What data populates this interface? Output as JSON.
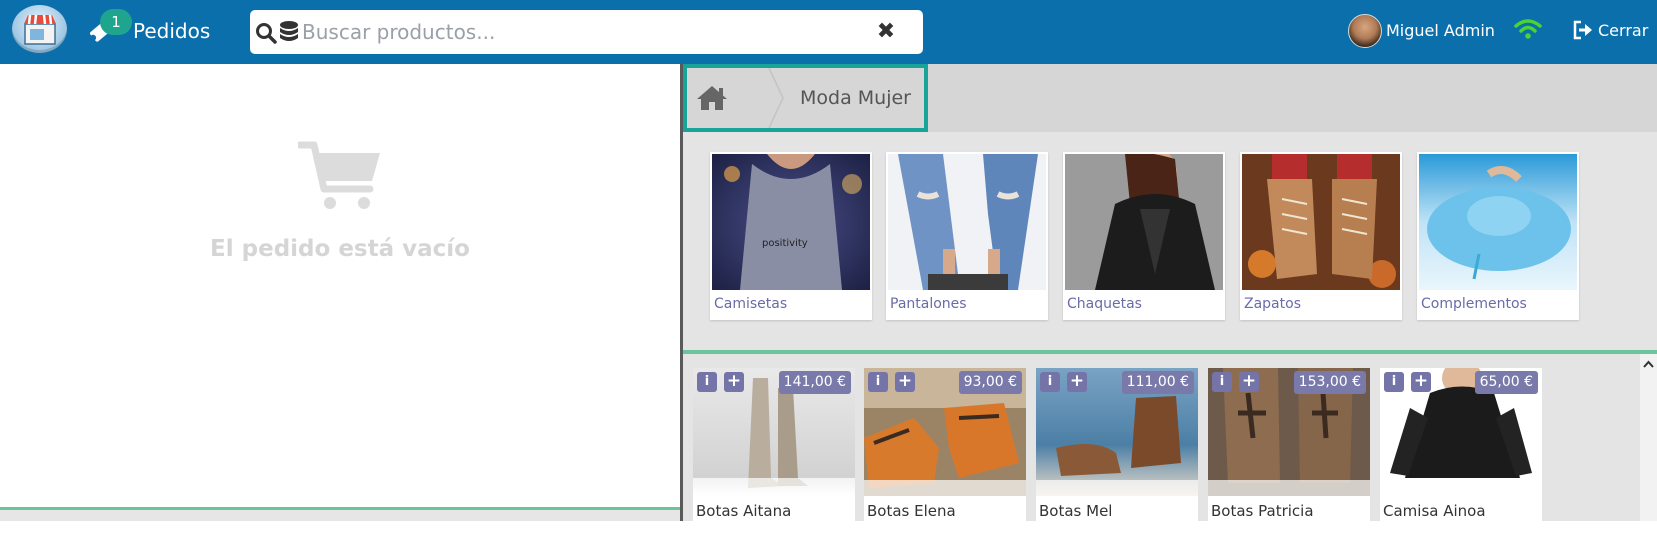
{
  "header": {
    "logo_icon": "store-icon",
    "orders_badge": "1",
    "orders_label": "Pedidos",
    "search": {
      "placeholder": "Buscar productos...",
      "value": ""
    },
    "user_name": "Miguel Admin",
    "logout_label": "Cerrar",
    "colors": {
      "bar": "#0b6fac",
      "badge": "#1fa48d",
      "wifi": "#4cd137"
    }
  },
  "order_panel": {
    "empty_message": "El pedido está vacío",
    "icon": "cart-icon"
  },
  "breadcrumb": {
    "home_icon": "home-icon",
    "current": "Moda Mujer"
  },
  "categories": [
    {
      "label": "Camisetas",
      "image": "t-shirt-photo"
    },
    {
      "label": "Pantalones",
      "image": "jeans-photo"
    },
    {
      "label": "Chaquetas",
      "image": "jacket-photo"
    },
    {
      "label": "Zapatos",
      "image": "boots-photo"
    },
    {
      "label": "Complementos",
      "image": "hat-photo"
    }
  ],
  "products": [
    {
      "name": "Botas Aitana",
      "price": "141,00 €"
    },
    {
      "name": "Botas Elena",
      "price": "93,00 €"
    },
    {
      "name": "Botas Mel",
      "price": "111,00 €"
    },
    {
      "name": "Botas Patricia",
      "price": "153,00 €"
    },
    {
      "name": "Camisa Ainoa",
      "price": "65,00 €"
    }
  ]
}
